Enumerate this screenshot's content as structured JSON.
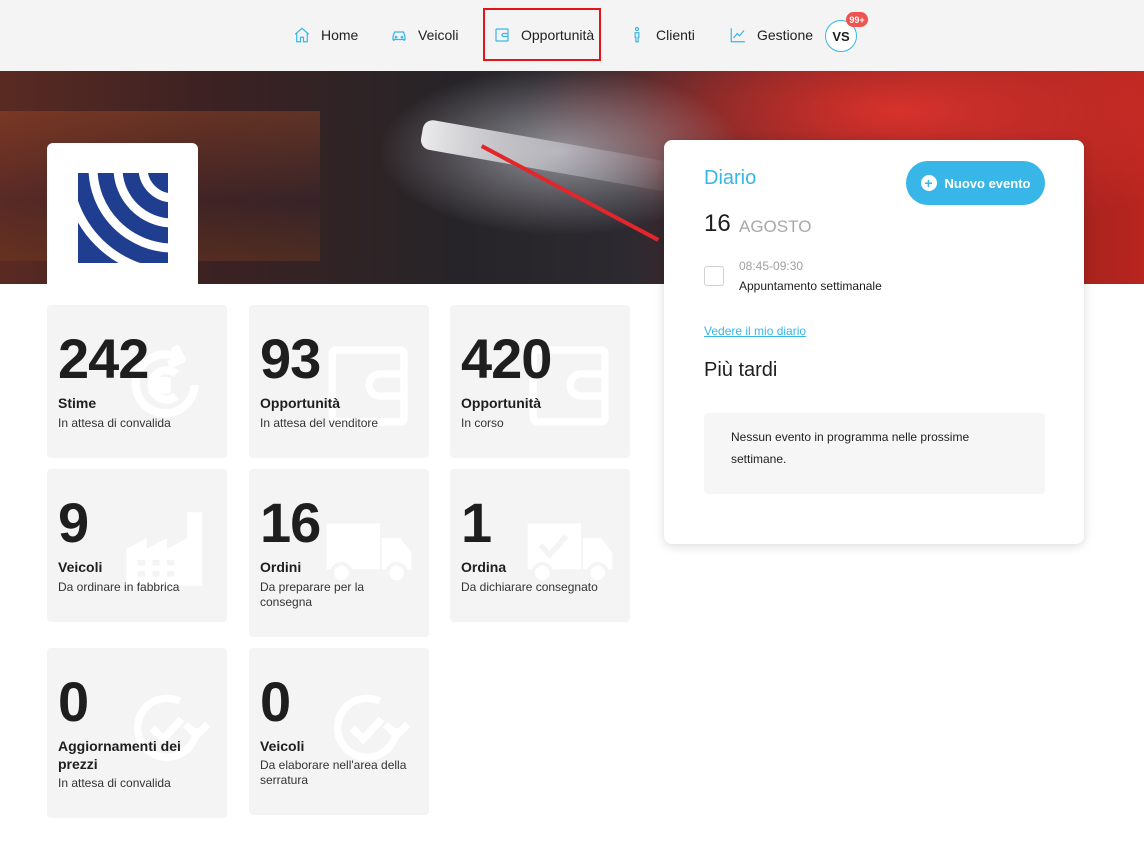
{
  "nav": {
    "items": [
      {
        "label": "Home",
        "icon": "home-icon"
      },
      {
        "label": "Veicoli",
        "icon": "car-icon"
      },
      {
        "label": "Opportunità",
        "icon": "wallet-icon"
      },
      {
        "label": "Clienti",
        "icon": "person-icon"
      },
      {
        "label": "Gestione",
        "icon": "chart-line-icon"
      }
    ],
    "active_item": "Opportunità",
    "avatar_initials": "VS",
    "notification_badge": "99+"
  },
  "colors": {
    "accent": "#38b6e8",
    "badge": "#ef5350",
    "highlight": "#e3151a",
    "card_bg": "#f4f4f4",
    "logo_blue": "#1f3e8f"
  },
  "stats": [
    {
      "number": "242",
      "title": "Stime",
      "subtitle": "In attesa di convalida",
      "icon": "euro-refresh-icon"
    },
    {
      "number": "93",
      "title": "Opportunità",
      "subtitle": "In attesa del venditore",
      "icon": "wallet-icon"
    },
    {
      "number": "420",
      "title": "Opportunità",
      "subtitle": "In corso",
      "icon": "wallet-icon"
    },
    {
      "number": "9",
      "title": "Veicoli",
      "subtitle": "Da ordinare in fabbrica",
      "icon": "factory-icon"
    },
    {
      "number": "16",
      "title": "Ordini",
      "subtitle": "Da preparare per la consegna",
      "icon": "truck-icon"
    },
    {
      "number": "1",
      "title": "Ordina",
      "subtitle": "Da dichiarare consegnato",
      "icon": "truck-check-icon"
    },
    {
      "number": "0",
      "title": "Aggiornamenti dei prezzi",
      "subtitle": "In attesa di convalida",
      "icon": "refresh-check-icon"
    },
    {
      "number": "0",
      "title": "Veicoli",
      "subtitle": "Da elaborare nell'area della serratura",
      "icon": "refresh-check-icon"
    }
  ],
  "diary": {
    "title": "Diario",
    "new_event_label": "Nuovo evento",
    "date_day": "16",
    "date_month": "AGOSTO",
    "event": {
      "time": "08:45-09:30",
      "name": "Appuntamento settimanale"
    },
    "link_label": "Vedere il mio diario",
    "later_title": "Più tardi",
    "empty_message": "Nessun evento in programma nelle prossime settimane."
  }
}
